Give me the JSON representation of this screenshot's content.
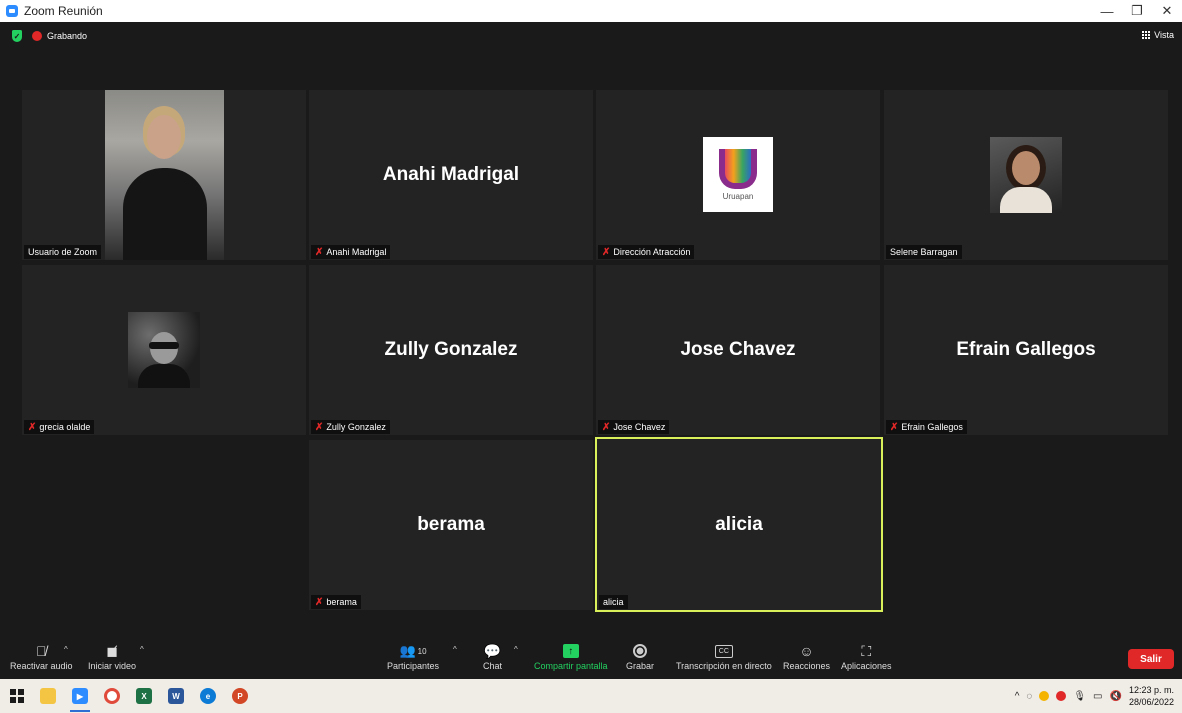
{
  "window": {
    "title": "Zoom Reunión",
    "minimize": "—",
    "maximize": "❐",
    "close": "✕"
  },
  "meeting": {
    "recording_label": "Grabando",
    "view_label": "Vista"
  },
  "tiles": [
    {
      "label": "Usuario de Zoom",
      "muted": false
    },
    {
      "center_name": "Anahi Madrigal",
      "label": "Anahi Madrigal",
      "muted": true
    },
    {
      "label": "Dirección Atracción",
      "muted": true,
      "logo_text": "Uruapan"
    },
    {
      "label": "Selene Barragan",
      "muted": false
    },
    {
      "label": "grecia olalde",
      "muted": true
    },
    {
      "center_name": "Zully Gonzalez",
      "label": "Zully Gonzalez",
      "muted": true
    },
    {
      "center_name": "Jose Chavez",
      "label": "Jose Chavez",
      "muted": true
    },
    {
      "center_name": "Efrain Gallegos",
      "label": "Efrain Gallegos",
      "muted": true
    },
    {
      "center_name": "berama",
      "label": "berama",
      "muted": true
    },
    {
      "center_name": "alicia",
      "label": "alicia",
      "muted": false,
      "active_speaker": true
    }
  ],
  "toolbar": {
    "unmute_label": "Reactivar audio",
    "start_video_label": "Iniciar video",
    "participants_label": "Participantes",
    "participants_count": "10",
    "chat_label": "Chat",
    "share_label": "Compartir pantalla",
    "record_label": "Grabar",
    "transcription_label": "Transcripción en directo",
    "reactions_label": "Reacciones",
    "apps_label": "Aplicaciones",
    "leave_label": "Salir",
    "cc_text": "CC"
  },
  "taskbar": {
    "time": "12:23 p. m.",
    "date": "28/06/2022",
    "icons": [
      "windows-start",
      "file-explorer",
      "zoom",
      "chrome",
      "excel",
      "word",
      "edge",
      "powerpoint"
    ]
  },
  "colors": {
    "accent_green": "#23d160",
    "leave_red": "#e02828",
    "active_border": "#d9f05a",
    "tile_bg": "#232323"
  }
}
